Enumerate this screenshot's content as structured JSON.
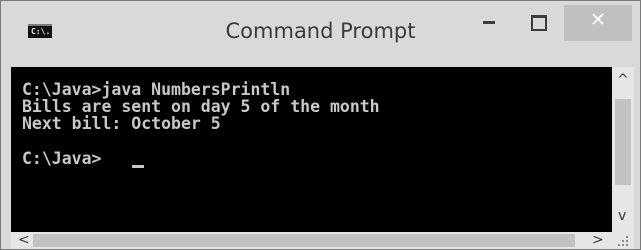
{
  "window": {
    "title": "Command Prompt",
    "icon_label": "C:\\.",
    "buttons": {
      "minimize": "minimize-icon",
      "maximize": "maximize-icon",
      "close": "close-icon",
      "close_glyph": "✕"
    }
  },
  "console": {
    "lines": [
      "C:\\Java>java NumbersPrintln",
      "Bills are sent on day 5 of the month",
      "Next bill: October 5",
      "",
      "C:\\Java>"
    ]
  },
  "scrollbars": {
    "up_glyph": "^",
    "down_glyph": "v",
    "left_glyph": "<",
    "right_glyph": ">"
  },
  "colors": {
    "console_bg": "#000000",
    "console_text": "#c8c8c8",
    "chrome": "#d9d9d9",
    "close_button": "#c0c0c0"
  }
}
